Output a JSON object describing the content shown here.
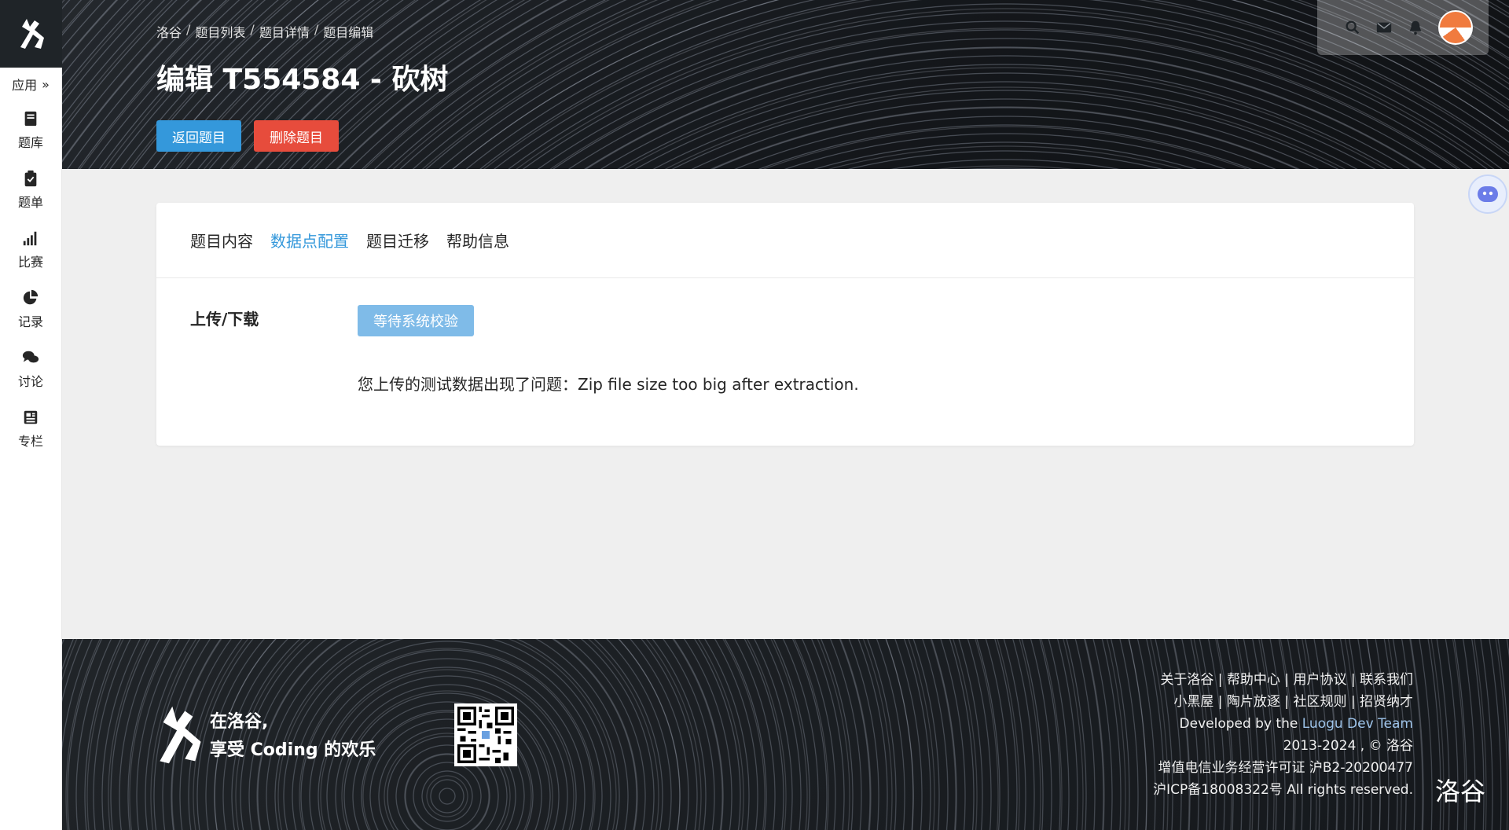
{
  "sidebar": {
    "apps_label": "应用",
    "items": [
      {
        "label": "题库",
        "icon": "book-icon"
      },
      {
        "label": "题单",
        "icon": "clipboard-icon"
      },
      {
        "label": "比赛",
        "icon": "signal-bars-icon"
      },
      {
        "label": "记录",
        "icon": "pie-chart-icon"
      },
      {
        "label": "讨论",
        "icon": "chat-bubbles-icon"
      },
      {
        "label": "专栏",
        "icon": "newspaper-icon"
      }
    ]
  },
  "header": {
    "breadcrumb": [
      "洛谷",
      "题目列表",
      "题目详情",
      "题目编辑"
    ],
    "title": "编辑 T554584 - 砍树",
    "back_button": "返回题目",
    "delete_button": "删除题目"
  },
  "tabs": [
    "题目内容",
    "数据点配置",
    "题目迁移",
    "帮助信息"
  ],
  "active_tab": "数据点配置",
  "upload": {
    "label": "上传/下载",
    "status_button": "等待系统校验",
    "error_message": "您上传的测试数据出现了问题：Zip file size too big after extraction."
  },
  "footer": {
    "slogan_line1": "在洛谷,",
    "slogan_line2": "享受 Coding 的欢乐",
    "links_row1": [
      "关于洛谷",
      "帮助中心",
      "用户协议",
      "联系我们"
    ],
    "links_row2": [
      "小黑屋",
      "陶片放逐",
      "社区规则",
      "招贤纳才"
    ],
    "developed_prefix": "Developed by the",
    "developed_team": "Luogu Dev Team",
    "copyright": "2013-2024 , © 洛谷",
    "license": "增值电信业务经营许可证 沪B2-20200477",
    "icp": "沪ICP备18008322号 All rights reserved.",
    "watermark": "洛谷"
  },
  "colors": {
    "primary": "#3498db",
    "danger": "#e74c3c",
    "pending": "#7fbbe8",
    "sidebar_logo_bg": "#1f2428"
  }
}
